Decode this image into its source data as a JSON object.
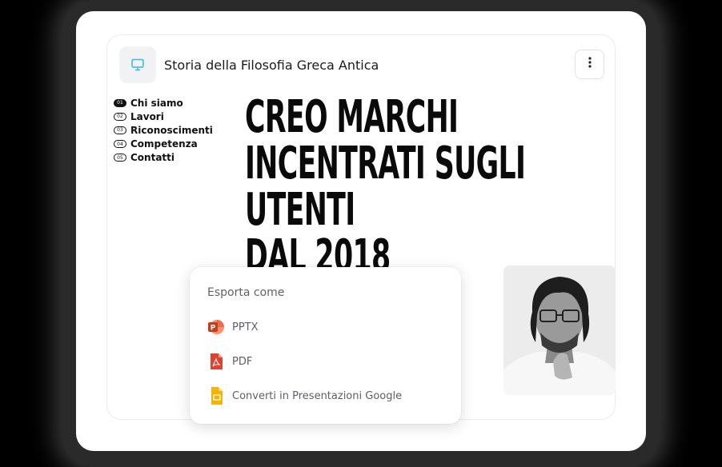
{
  "document": {
    "title": "Storia della Filosofia Greca Antica",
    "app_icon": "presentation-icon",
    "more_icon": "more-vertical-icon"
  },
  "slide": {
    "nav": [
      {
        "num": "01",
        "label": "Chi siamo",
        "active": true
      },
      {
        "num": "02",
        "label": "Lavori",
        "active": false
      },
      {
        "num": "03",
        "label": "Riconoscimenti",
        "active": false
      },
      {
        "num": "04",
        "label": "Competenza",
        "active": false
      },
      {
        "num": "05",
        "label": "Contatti",
        "active": false
      }
    ],
    "headline": [
      "CREO MARCHI",
      "INCENTRATI SUGLI",
      "UTENTI",
      "DAL 2018"
    ],
    "photo": "portrait-photo"
  },
  "export_menu": {
    "title": "Esporta come",
    "items": [
      {
        "label": "PPTX",
        "icon": "powerpoint-icon",
        "color": "#d24726"
      },
      {
        "label": "PDF",
        "icon": "pdf-icon",
        "color": "#e2412e"
      },
      {
        "label": "Converti in Presentazioni Google",
        "icon": "google-slides-icon",
        "color": "#f4b400"
      }
    ]
  },
  "colors": {
    "accent_icon": "#3ab7e6",
    "text_dark": "#0a0a0a"
  }
}
